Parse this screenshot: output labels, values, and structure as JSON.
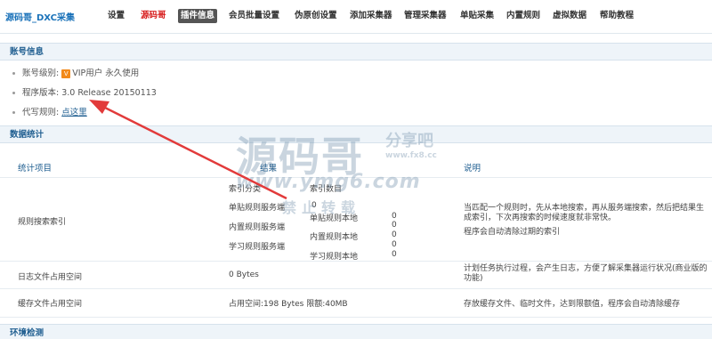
{
  "topnav": {
    "brand": "源码哥_DXC采集",
    "items": [
      "设置",
      "源码哥",
      "插件信息",
      "会员批量设置",
      "伪原创设置",
      "添加采集器",
      "管理采集器",
      "单贴采集",
      "内置规则",
      "虚拟数据",
      "帮助教程"
    ]
  },
  "account": {
    "section_title": "账号信息",
    "level_label": "账号级别:",
    "level_value": "VIP用户 永久使用",
    "version_label": "程序版本:",
    "version_value": "3.0 Release 20150113",
    "rule_label": "代写规则:",
    "rule_link": "点这里"
  },
  "stats": {
    "section_title": "数据统计",
    "headers": [
      "统计项目",
      "结果",
      "说明"
    ],
    "rule_search": {
      "name": "规则搜索索引",
      "inner_headers": [
        "索引分类",
        "索引数目"
      ],
      "rows": [
        {
          "label": "单贴规则服务端",
          "value": "0"
        },
        {
          "label": "单贴规则本地",
          "value": "0"
        },
        {
          "label": "内置规则服务端",
          "value": "0"
        },
        {
          "label": "内置规则本地",
          "value": "0"
        },
        {
          "label": "学习规则服务端",
          "value": "0"
        },
        {
          "label": "学习规则本地",
          "value": "0"
        }
      ],
      "desc": "当匹配一个规则时，先从本地搜索，再从服务端搜索，然后把结果生成索引，下次再搜索的时候速度就非常快。",
      "desc2": "程序会自动清除过期的索引"
    },
    "log": {
      "name": "日志文件占用空间",
      "value": "0 Bytes",
      "desc": "计划任务执行过程，会产生日志，方便了解采集器运行状况(商业版的功能)"
    },
    "cache": {
      "name": "缓存文件占用空间",
      "value": "占用空间:198 Bytes 限额:40MB",
      "desc": "存放缓存文件、临时文件，达到限额值，程序会自动清除缓存"
    }
  },
  "env": {
    "section_title": "环境检测"
  },
  "watermark": {
    "big": "源码哥",
    "side": "分享吧",
    "site": "www.fx8.cc",
    "url": "www.ymg6.com",
    "sub": "禁止转载"
  },
  "colors": {
    "link": "#1f5e90",
    "brand": "#1a72b9",
    "active_tab": "#555555",
    "red_tab": "#d82020",
    "arrow": "#e23b3b",
    "section_bg": "#eef4f9"
  }
}
